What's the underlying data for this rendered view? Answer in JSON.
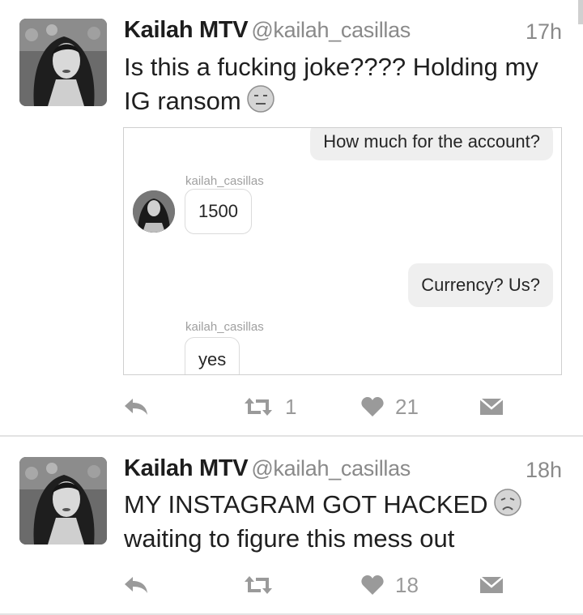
{
  "tweets": [
    {
      "name": "Kailah MTV",
      "handle": "@kailah_casillas",
      "time": "17h",
      "text_line1": "Is this a fucking joke???? Holding my",
      "text_line2": "IG ransom",
      "emoji": "expressionless-face-icon",
      "media": {
        "messages": [
          {
            "from": "me",
            "text": "How much for the account?"
          },
          {
            "from": "kailah_casillas",
            "user": "kailah_casillas",
            "text": "1500"
          },
          {
            "from": "me",
            "text": "Currency? Us?"
          },
          {
            "from": "kailah_casillas",
            "user": "kailah_casillas",
            "text": "yes"
          }
        ]
      },
      "retweets": "1",
      "likes": "21"
    },
    {
      "name": "Kailah MTV",
      "handle": "@kailah_casillas",
      "time": "18h",
      "text_line1": "MY INSTAGRAM GOT HACKED",
      "text_line2": "waiting to figure this mess out",
      "emoji": "disappointed-face-icon",
      "retweets": "",
      "likes": "18"
    }
  ],
  "colors": {
    "icon_gray": "#9a9a9a",
    "divider": "#e3e3e3",
    "text": "#1f1f1f"
  }
}
